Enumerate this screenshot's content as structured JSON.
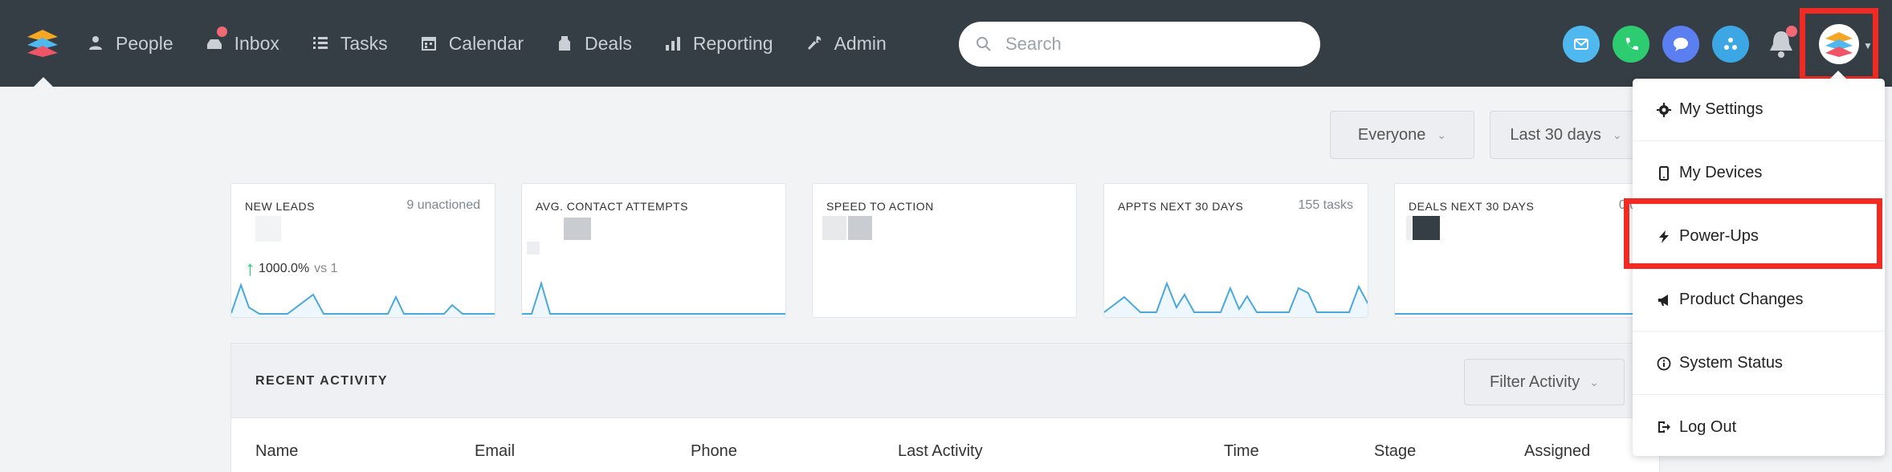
{
  "nav": {
    "items": [
      {
        "label": "People",
        "icon": "people-icon"
      },
      {
        "label": "Inbox",
        "icon": "inbox-icon"
      },
      {
        "label": "Tasks",
        "icon": "tasks-icon"
      },
      {
        "label": "Calendar",
        "icon": "calendar-icon"
      },
      {
        "label": "Deals",
        "icon": "deals-icon"
      },
      {
        "label": "Reporting",
        "icon": "reporting-icon"
      },
      {
        "label": "Admin",
        "icon": "admin-icon"
      }
    ]
  },
  "search": {
    "placeholder": "Search"
  },
  "header_icons": [
    {
      "name": "email-icon",
      "color": "#4fb8ef"
    },
    {
      "name": "phone-icon",
      "color": "#2ecc71"
    },
    {
      "name": "chat-icon",
      "color": "#5b7ff0"
    },
    {
      "name": "integration-icon",
      "color": "#3da7e6"
    }
  ],
  "filters": {
    "everyone": "Everyone",
    "period": "Last 30 days"
  },
  "cards": [
    {
      "title": "NEW LEADS",
      "aside": "9 unactioned",
      "trend_value": "1000.0%",
      "trend_vs": "vs 1"
    },
    {
      "title": "AVG. CONTACT ATTEMPTS",
      "aside": ""
    },
    {
      "title": "SPEED TO ACTION",
      "aside": ""
    },
    {
      "title": "APPTS NEXT 30 DAYS",
      "aside": "155 tasks"
    },
    {
      "title": "DEALS NEXT 30 DAYS",
      "aside": "0 de"
    }
  ],
  "activity": {
    "title": "RECENT ACTIVITY",
    "filter_label": "Filter Activity",
    "columns": [
      "Name",
      "Email",
      "Phone",
      "Last Activity",
      "Time",
      "Stage",
      "Assigned"
    ]
  },
  "dropdown": {
    "items": [
      {
        "label": "My Settings",
        "icon": "gear-icon"
      },
      {
        "label": "My Devices",
        "icon": "phone-device-icon"
      },
      {
        "label": "Power-Ups",
        "icon": "lightning-icon"
      },
      {
        "label": "Product Changes",
        "icon": "megaphone-icon"
      },
      {
        "label": "System Status",
        "icon": "info-icon"
      },
      {
        "label": "Log Out",
        "icon": "logout-icon"
      }
    ]
  },
  "colors": {
    "topbar": "#353d45",
    "highlight": "#f12b23",
    "sparkline": "#4aa8dc"
  }
}
